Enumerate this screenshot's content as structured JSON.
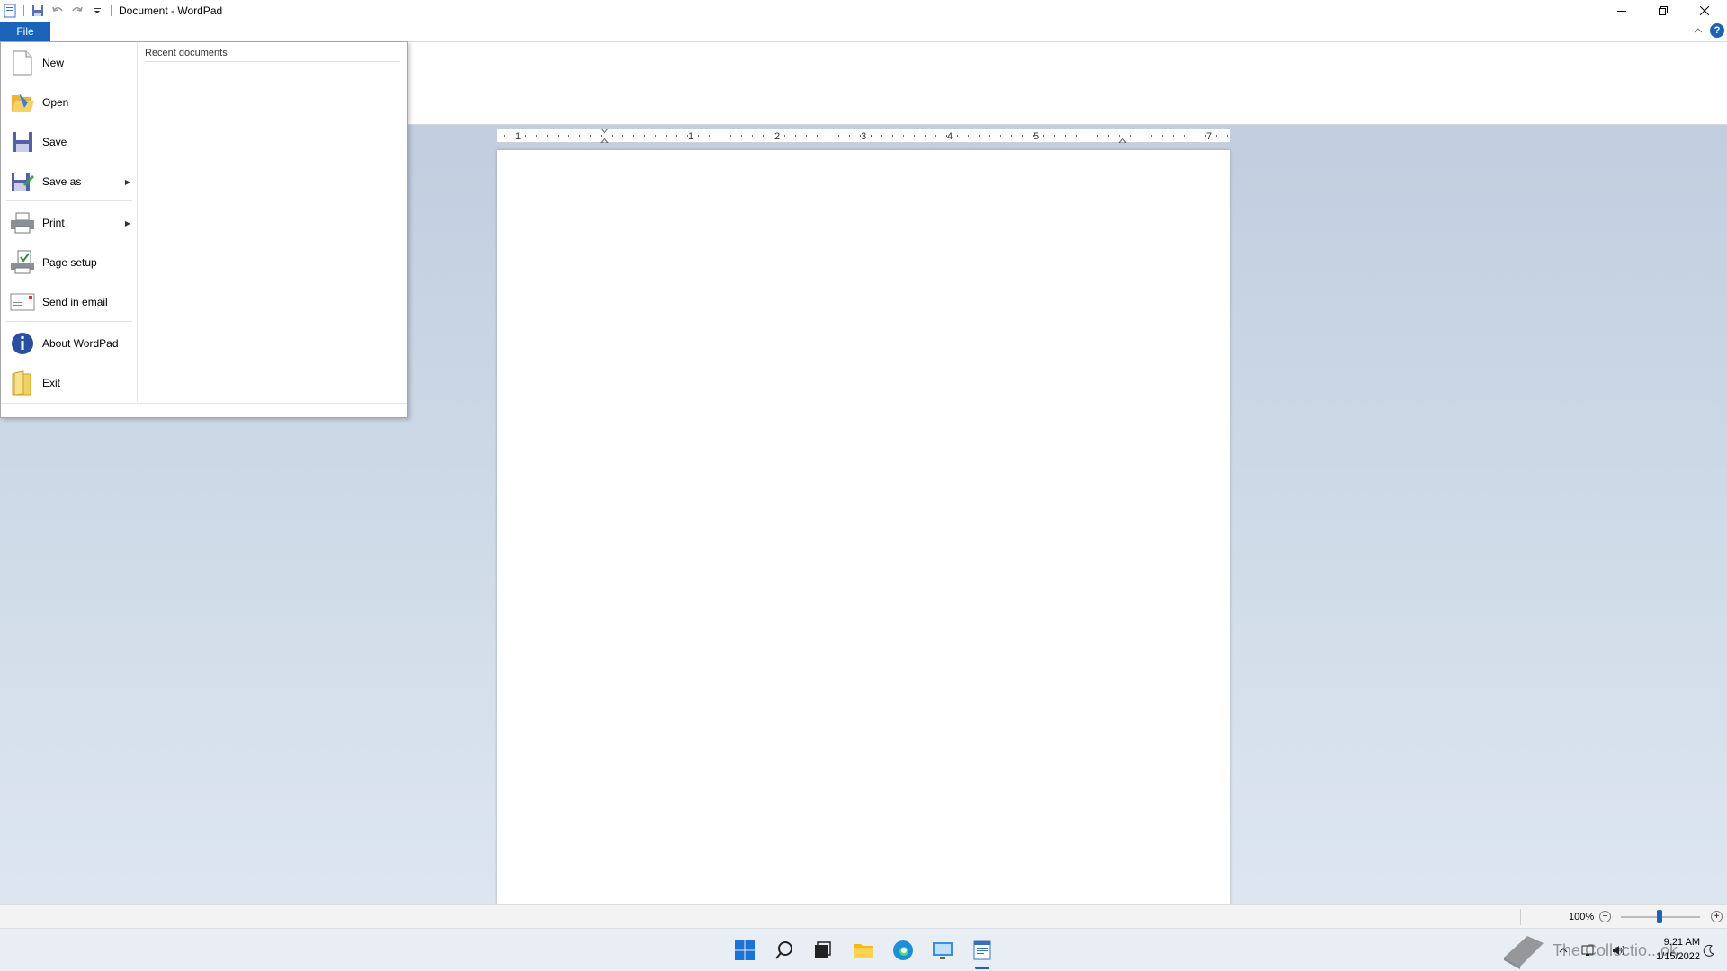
{
  "window": {
    "title": "Document - WordPad",
    "controls": {
      "minimize": "minimize-icon",
      "restore": "restore-icon",
      "close": "close-icon"
    }
  },
  "qat": [
    "wordpad-app-icon",
    "save-icon",
    "undo-icon",
    "redo-icon",
    "customize-qat-icon"
  ],
  "ribbon": {
    "file_tab": "File",
    "help": "?"
  },
  "file_menu": {
    "recent_header": "Recent documents",
    "items": [
      {
        "label": "New",
        "icon": "new-document-icon",
        "submenu": false
      },
      {
        "label": "Open",
        "icon": "open-folder-icon",
        "submenu": false
      },
      {
        "label": "Save",
        "icon": "save-icon",
        "submenu": false
      },
      {
        "label": "Save as",
        "icon": "save-as-icon",
        "submenu": true
      },
      {
        "label": "Print",
        "icon": "printer-icon",
        "submenu": true
      },
      {
        "label": "Page setup",
        "icon": "page-setup-icon",
        "submenu": false
      },
      {
        "label": "Send in email",
        "icon": "email-icon",
        "submenu": false
      },
      {
        "label": "About WordPad",
        "icon": "info-icon",
        "submenu": false
      },
      {
        "label": "Exit",
        "icon": "exit-icon",
        "submenu": false
      }
    ]
  },
  "ruler": {
    "labels": [
      "1",
      "1",
      "2",
      "3",
      "4",
      "5",
      "7"
    ]
  },
  "statusbar": {
    "zoom": "100%",
    "zoom_value_percent": 100
  },
  "taskbar": {
    "icons": [
      "windows-start-icon",
      "search-icon",
      "task-view-icon",
      "file-explorer-icon",
      "edge-icon",
      "control-panel-icon",
      "wordpad-taskbar-icon"
    ],
    "time": "9:21 AM",
    "date": "1/15/2022",
    "watermark": "The Collectio...ok"
  },
  "colors": {
    "accent": "#1a63b8",
    "doc_background": "#c9d5e4"
  }
}
